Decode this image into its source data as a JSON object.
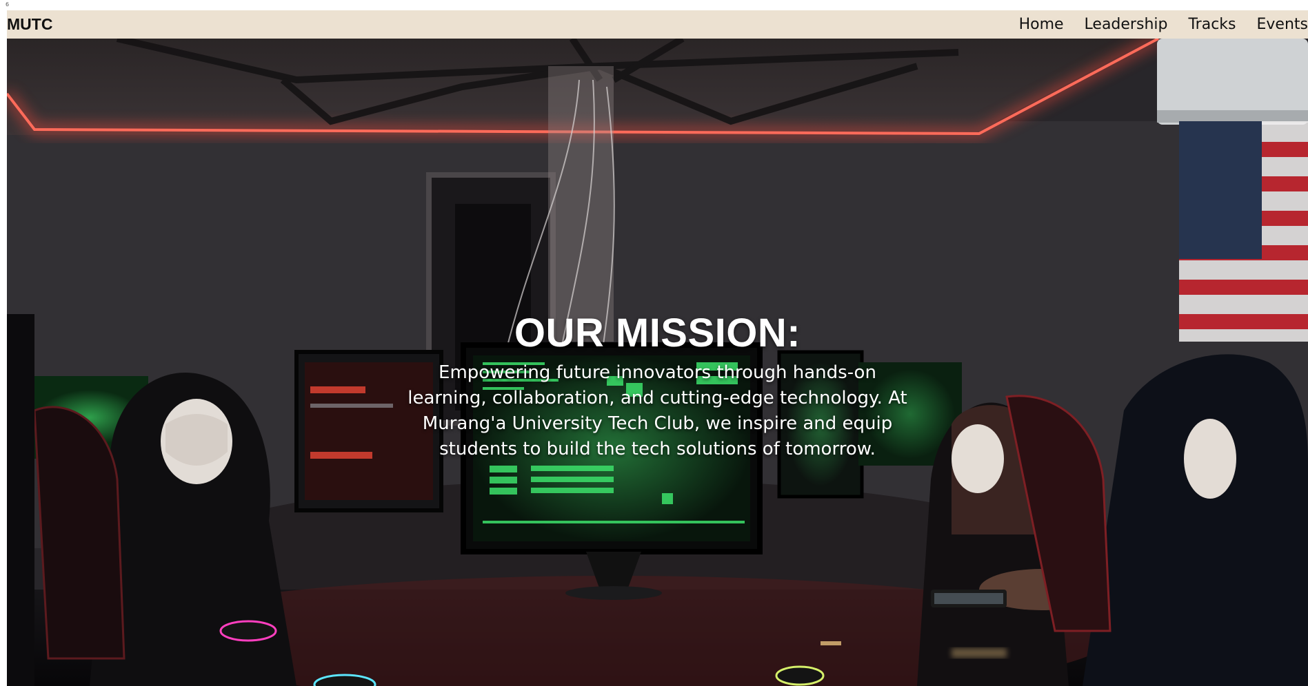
{
  "corner_mark": "6",
  "nav": {
    "brand": "MUTC",
    "links": [
      "Home",
      "Leadership",
      "Tracks",
      "Events"
    ]
  },
  "hero": {
    "title": "OUR MISSION:",
    "text": "Empowering future innovators through hands-on learning, collaboration, and cutting-edge technology. At Murang'a University Tech Club, we inspire and equip students to build the tech solutions of tomorrow."
  },
  "colors": {
    "nav_bg": "#ece1d1",
    "neon_red": "#ff4a3a",
    "screen_green": "#38d35a"
  }
}
